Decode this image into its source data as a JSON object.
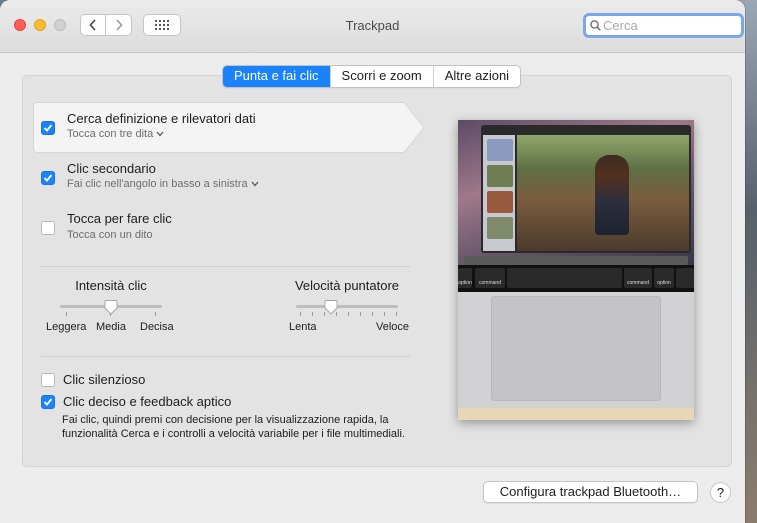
{
  "window": {
    "title": "Trackpad"
  },
  "search": {
    "placeholder": "Cerca"
  },
  "tabs": [
    {
      "label": "Punta e fai clic",
      "active": true
    },
    {
      "label": "Scorri e zoom",
      "active": false
    },
    {
      "label": "Altre azioni",
      "active": false
    }
  ],
  "options": [
    {
      "title": "Cerca definizione e rilevatori dati",
      "subtitle": "Tocca con tre dita",
      "checked": true,
      "has_dropdown": true
    },
    {
      "title": "Clic secondario",
      "subtitle": "Fai clic nell'angolo in basso a sinistra",
      "checked": true,
      "has_dropdown": true
    },
    {
      "title": "Tocca per fare clic",
      "subtitle": "Tocca con un dito",
      "checked": false,
      "has_dropdown": false
    }
  ],
  "sliders": {
    "click_intensity": {
      "label": "Intensità clic",
      "min_label": "Leggera",
      "mid_label": "Media",
      "max_label": "Decisa",
      "value": 0.5
    },
    "pointer_speed": {
      "label": "Velocità puntatore",
      "min_label": "Lenta",
      "max_label": "Veloce",
      "value": 0.4
    }
  },
  "silent_click": {
    "label": "Clic silenzioso",
    "checked": false
  },
  "force_click": {
    "label": "Clic deciso e feedback aptico",
    "checked": true,
    "description": "Fai clic, quindi premi con decisione per la visualizzazione rapida, la funzionalità Cerca e i controlli a velocità variabile per i file multimediali."
  },
  "preview": {
    "keys": {
      "option": "option",
      "command": "command"
    }
  },
  "footer": {
    "bluetooth_button": "Configura trackpad Bluetooth…",
    "help_label": "?"
  },
  "colors": {
    "accent": "#1a82fb",
    "close": "#fe5f57",
    "minimize": "#febc2e"
  },
  "icons": [
    "chevron-left-icon",
    "chevron-right-icon",
    "grid-icon",
    "search-icon",
    "checkmark-icon",
    "chevron-down-icon",
    "help-icon"
  ]
}
